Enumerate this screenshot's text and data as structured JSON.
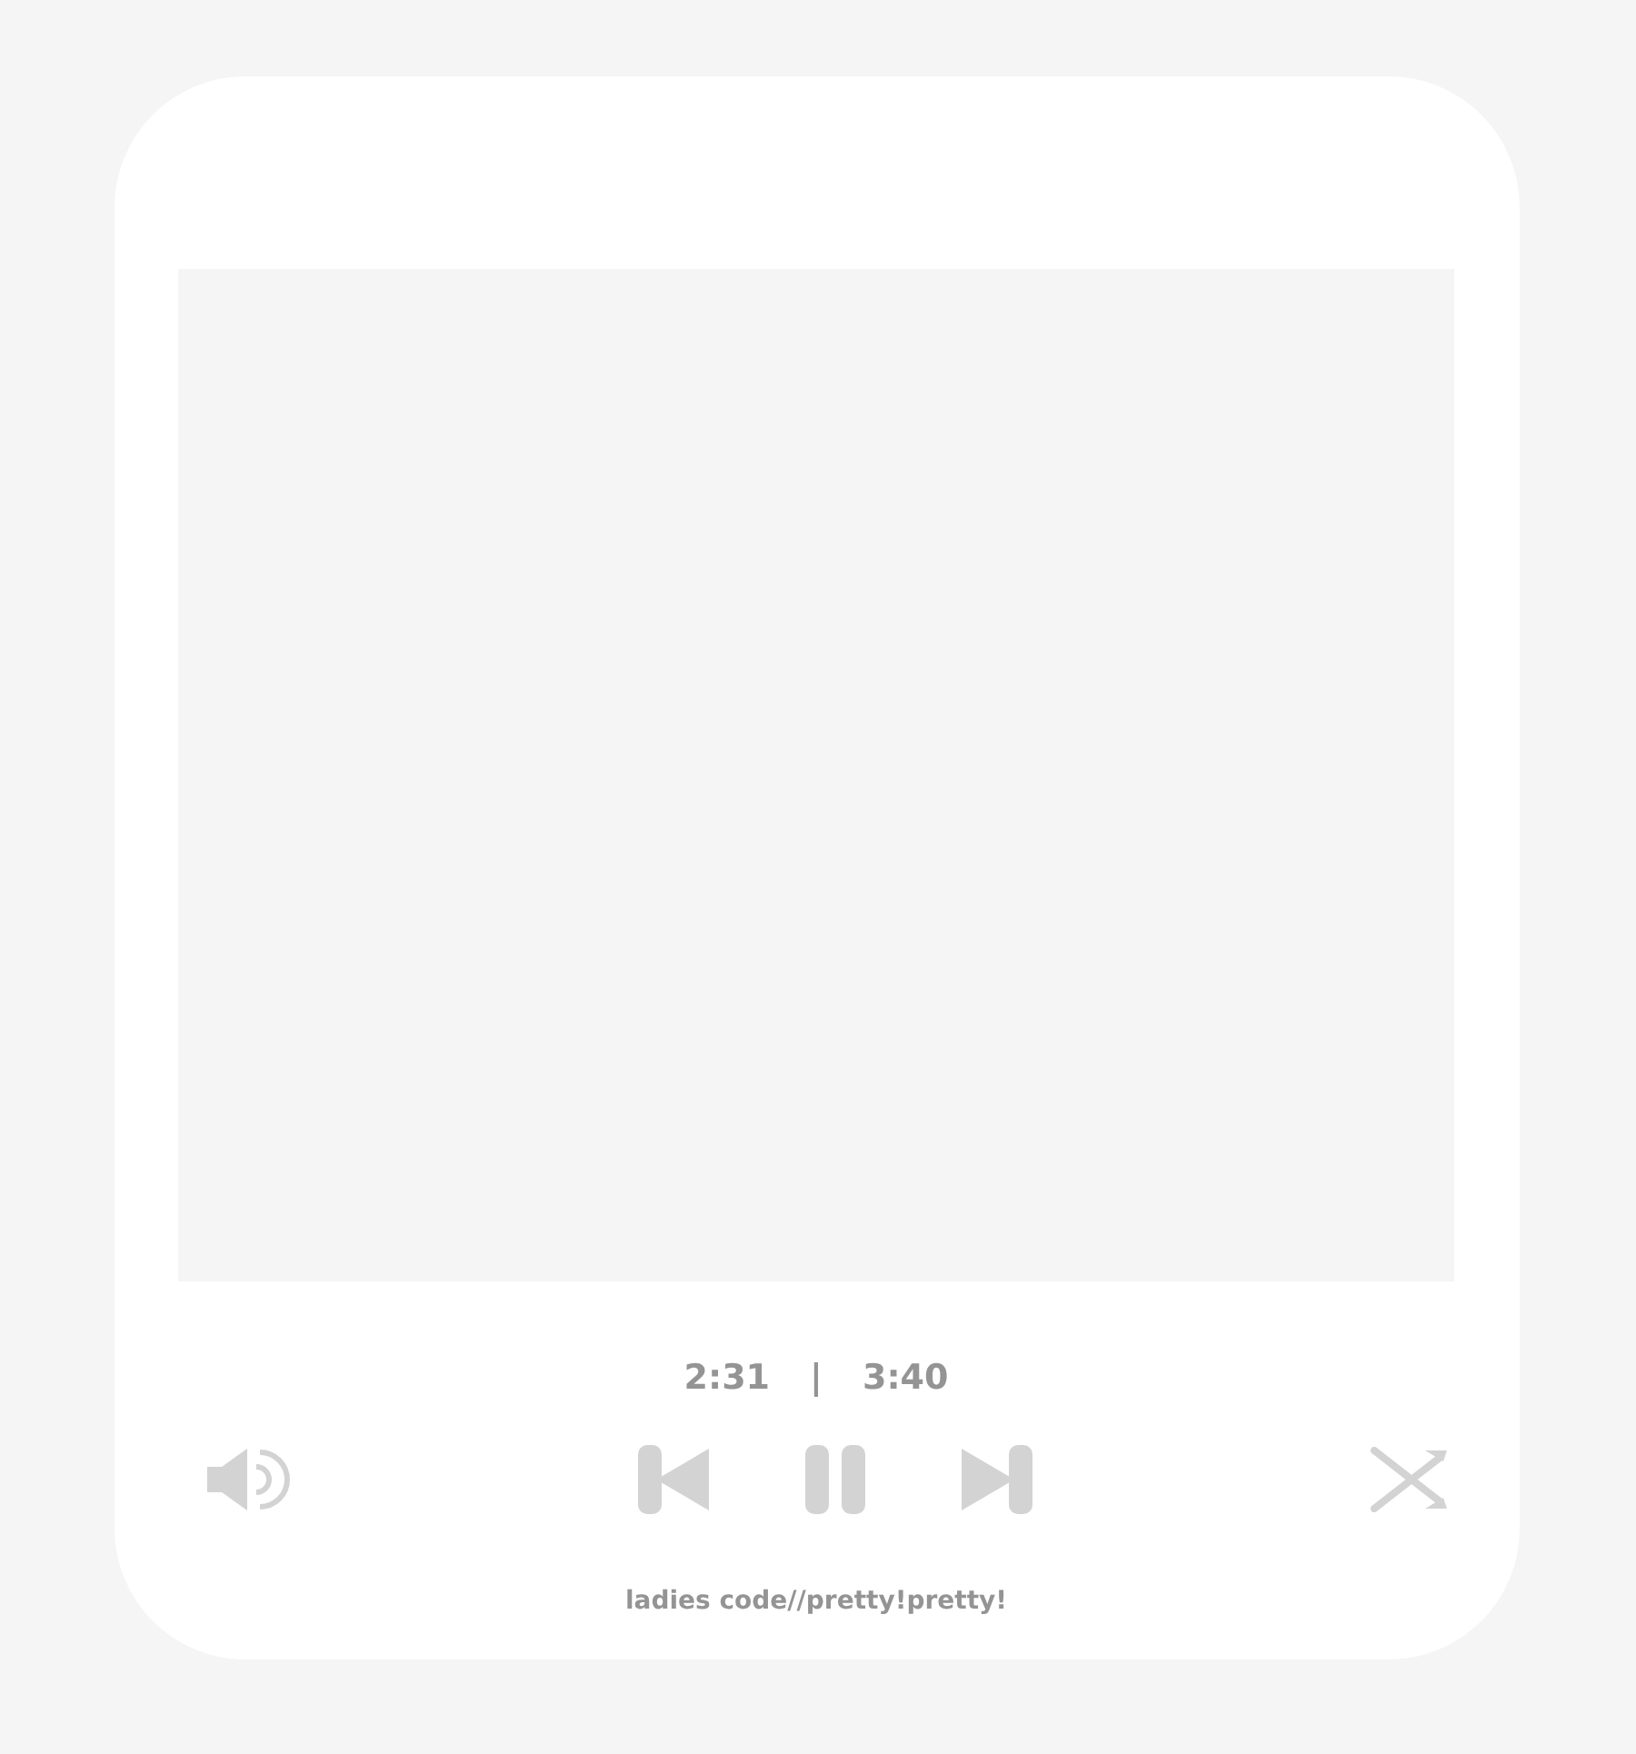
{
  "player": {
    "elapsed": "2:31",
    "separator": "|",
    "duration": "3:40",
    "playing": true,
    "track": "ladies code//pretty!pretty!"
  }
}
